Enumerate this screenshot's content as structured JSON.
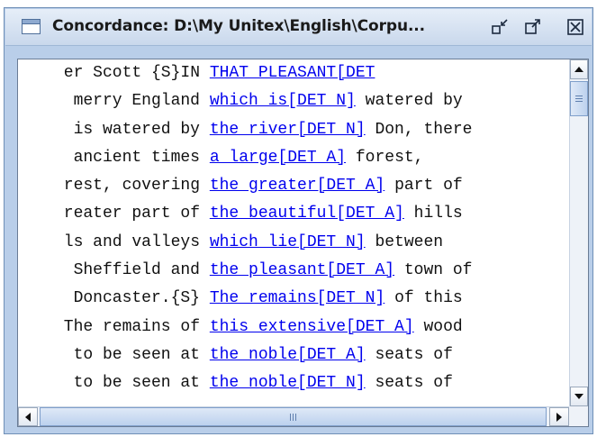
{
  "window": {
    "title": "Concordance: D:\\My Unitex\\English\\Corpu...",
    "icons": {
      "window": "window-icon",
      "iconify": "iconify-icon",
      "maximize": "maximize-icon",
      "close": "close-icon"
    }
  },
  "concordance": {
    "lines": [
      {
        "left": "er Scott {S}IN",
        "match": "THAT PLEASANT[DET",
        "right": ""
      },
      {
        "left": "merry England",
        "match": "which is[DET N]",
        "right": "watered by"
      },
      {
        "left": "is watered by",
        "match": "the river[DET N]",
        "right": "Don, there"
      },
      {
        "left": "ancient times",
        "match": "a large[DET A]",
        "right": "forest,"
      },
      {
        "left": "rest, covering",
        "match": "the greater[DET A]",
        "right": "part of"
      },
      {
        "left": "reater part of",
        "match": "the beautiful[DET A]",
        "right": "hills"
      },
      {
        "left": "ls and valleys",
        "match": "which lie[DET N]",
        "right": "between"
      },
      {
        "left": "Sheffield and",
        "match": "the pleasant[DET A]",
        "right": "town of"
      },
      {
        "left": "Doncaster.{S}",
        "match": "The remains[DET N]",
        "right": "of this"
      },
      {
        "left": "The remains of",
        "match": "this extensive[DET A]",
        "right": "wood"
      },
      {
        "left": "to be seen at",
        "match": "the noble[DET A]",
        "right": "seats of"
      },
      {
        "left": "to be seen at",
        "match": "the noble[DET N]",
        "right": "seats of"
      }
    ]
  },
  "colors": {
    "link": "#0000ee",
    "frame": "#b9cee9",
    "titlebar": "#c9d8ec"
  }
}
